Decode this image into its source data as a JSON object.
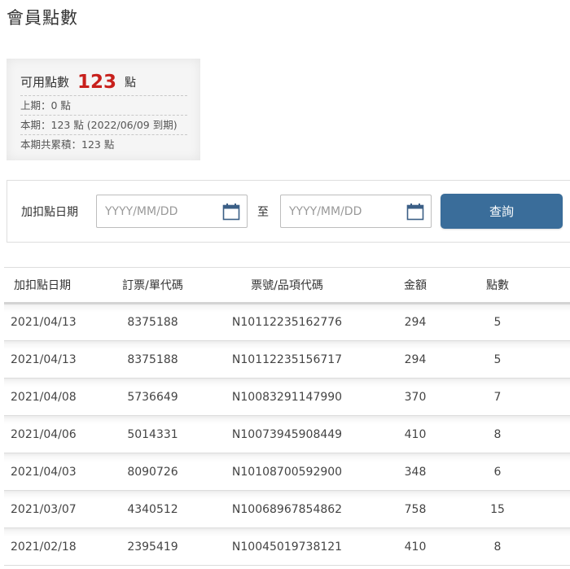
{
  "page": {
    "title": "會員點數"
  },
  "points_summary": {
    "available_label": "可用點數",
    "available_value": "123",
    "available_unit": "點",
    "previous_period": "上期：0 點",
    "current_period": "本期：123 點 (2022/06/09 到期)",
    "accumulated": "本期共累積：123 點"
  },
  "search": {
    "date_label": "加扣點日期",
    "start_placeholder": "YYYY/MM/DD",
    "to_label": "至",
    "end_placeholder": "YYYY/MM/DD",
    "submit_label": "查詢"
  },
  "table": {
    "headers": {
      "date": "加扣點日期",
      "order": "訂票/單代碼",
      "ticket": "票號/品項代碼",
      "amount": "金額",
      "points": "點數"
    },
    "rows": [
      {
        "date": "2021/04/13",
        "order": "8375188",
        "ticket": "N10112235162776",
        "amount": "294",
        "points": "5"
      },
      {
        "date": "2021/04/13",
        "order": "8375188",
        "ticket": "N10112235156717",
        "amount": "294",
        "points": "5"
      },
      {
        "date": "2021/04/08",
        "order": "5736649",
        "ticket": "N10083291147990",
        "amount": "370",
        "points": "7"
      },
      {
        "date": "2021/04/06",
        "order": "5014331",
        "ticket": "N10073945908449",
        "amount": "410",
        "points": "8"
      },
      {
        "date": "2021/04/03",
        "order": "8090726",
        "ticket": "N10108700592900",
        "amount": "348",
        "points": "6"
      },
      {
        "date": "2021/03/07",
        "order": "4340512",
        "ticket": "N10068967854862",
        "amount": "758",
        "points": "15"
      },
      {
        "date": "2021/02/18",
        "order": "2395419",
        "ticket": "N10045019738121",
        "amount": "410",
        "points": "8"
      }
    ]
  },
  "icons": {
    "calendar": "calendar-icon"
  },
  "colors": {
    "points_accent": "#c8201c",
    "button_bg": "#3a6d9a"
  }
}
